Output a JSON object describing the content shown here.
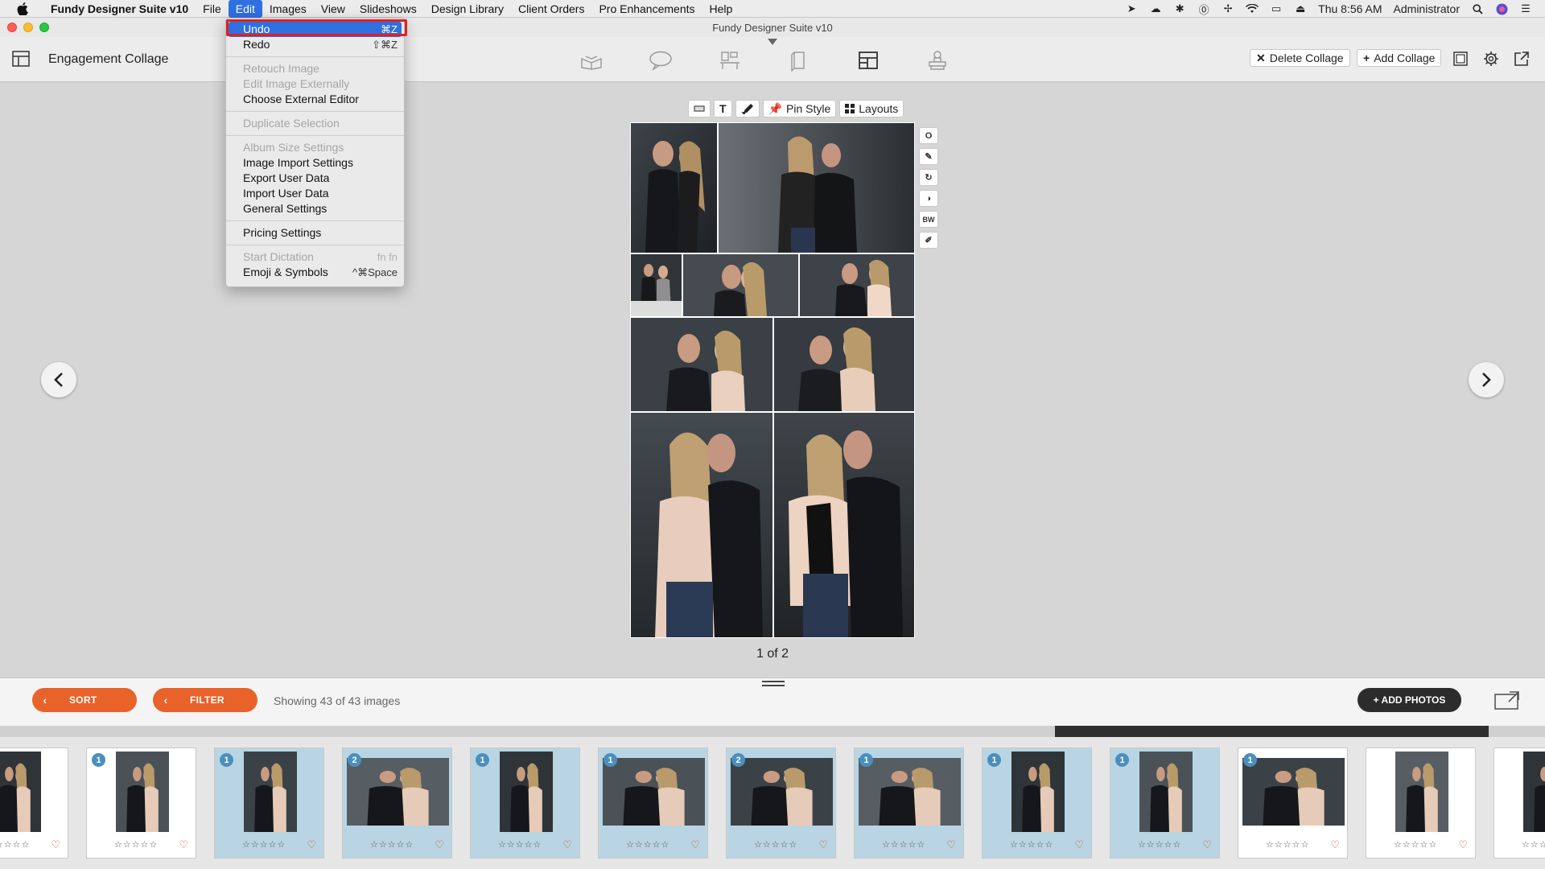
{
  "menubar": {
    "app_name": "Fundy Designer Suite v10",
    "items": [
      "File",
      "Edit",
      "Images",
      "View",
      "Slideshows",
      "Design Library",
      "Client Orders",
      "Pro Enhancements",
      "Help"
    ],
    "clock": "Thu 8:56 AM",
    "user": "Administrator"
  },
  "window": {
    "title": "Fundy Designer Suite v10"
  },
  "toolbar": {
    "page_title": "Engagement Collage",
    "delete_label": "Delete Collage",
    "add_label": "Add Collage"
  },
  "edit_menu": {
    "items": [
      {
        "label": "Undo",
        "shortcut": "⌘Z",
        "state": "highlighted"
      },
      {
        "label": "Redo",
        "shortcut": "⇧⌘Z",
        "state": "enabled"
      },
      {
        "label": "Retouch Image",
        "shortcut": "",
        "state": "disabled"
      },
      {
        "label": "Edit Image Externally",
        "shortcut": "",
        "state": "disabled"
      },
      {
        "label": "Choose External Editor",
        "shortcut": "",
        "state": "enabled"
      },
      {
        "label": "Duplicate Selection",
        "shortcut": "",
        "state": "disabled"
      },
      {
        "label": "Album Size Settings",
        "shortcut": "",
        "state": "disabled"
      },
      {
        "label": "Image Import Settings",
        "shortcut": "",
        "state": "enabled"
      },
      {
        "label": "Export User Data",
        "shortcut": "",
        "state": "enabled"
      },
      {
        "label": "Import User Data",
        "shortcut": "",
        "state": "enabled"
      },
      {
        "label": "General Settings",
        "shortcut": "",
        "state": "enabled"
      },
      {
        "label": "Pricing Settings",
        "shortcut": "",
        "state": "enabled"
      },
      {
        "label": "Start Dictation",
        "shortcut": "fn fn",
        "state": "disabled"
      },
      {
        "label": "Emoji & Symbols",
        "shortcut": "^⌘Space",
        "state": "enabled"
      }
    ]
  },
  "collage_tools": {
    "text_icon_label": "T",
    "pin_style": "Pin Style",
    "layouts": "Layouts"
  },
  "side_tools": {
    "circle_label": "O",
    "bw_label": "BW"
  },
  "collage": {
    "page_indicator": "1 of 2"
  },
  "controls": {
    "sort": "SORT",
    "filter": "FILTER",
    "showing": "Showing 43 of 43 images",
    "add_photos": "+ ADD PHOTOS"
  },
  "filmstrip": {
    "thumbs": [
      {
        "badge": "",
        "used": false,
        "orientation": "portrait"
      },
      {
        "badge": "1",
        "used": false,
        "orientation": "portrait"
      },
      {
        "badge": "1",
        "used": true,
        "orientation": "portrait"
      },
      {
        "badge": "2",
        "used": true,
        "orientation": "landscape"
      },
      {
        "badge": "1",
        "used": true,
        "orientation": "portrait"
      },
      {
        "badge": "1",
        "used": true,
        "orientation": "landscape"
      },
      {
        "badge": "2",
        "used": true,
        "orientation": "landscape"
      },
      {
        "badge": "1",
        "used": true,
        "orientation": "landscape"
      },
      {
        "badge": "1",
        "used": true,
        "orientation": "portrait"
      },
      {
        "badge": "1",
        "used": true,
        "orientation": "portrait"
      },
      {
        "badge": "1",
        "used": false,
        "orientation": "landscape"
      },
      {
        "badge": "",
        "used": false,
        "orientation": "portrait"
      },
      {
        "badge": "",
        "used": false,
        "orientation": "portrait"
      }
    ],
    "stars": "☆☆☆☆☆",
    "heart": "♡"
  },
  "colors": {
    "accent_orange": "#e8622a",
    "menu_highlight": "#2f6fe0",
    "used_thumb": "#b9d5e3",
    "undo_outline": "#e02020"
  }
}
